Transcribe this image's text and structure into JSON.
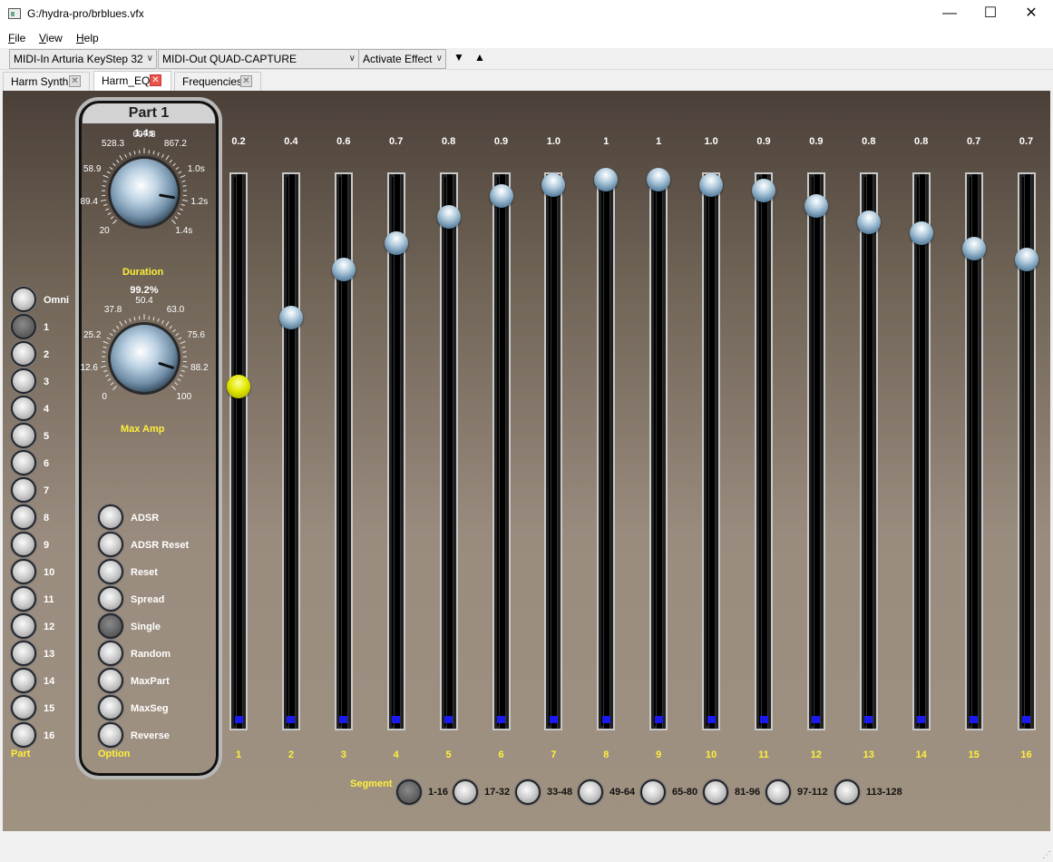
{
  "window": {
    "title": "G:/hydra-pro/brblues.vfx",
    "minimize": "—",
    "maximize": "☐",
    "close": "✕"
  },
  "menu": {
    "file": "File",
    "view": "View",
    "help": "Help"
  },
  "toolbar": {
    "midi_in": "MIDI-In Arturia KeyStep 32",
    "midi_out": "MIDI-Out QUAD-CAPTURE",
    "effect": "Activate Effect",
    "down_arrow": "▼",
    "up_arrow": "▲",
    "combo_arrow": "∨"
  },
  "tabs": [
    {
      "label": "Harm Synth",
      "active": false
    },
    {
      "label": "Harm_EQ",
      "active": true
    },
    {
      "label": "Frequencies",
      "active": false
    }
  ],
  "tab_close": "✕",
  "parts": {
    "items": [
      "Omni",
      "1",
      "2",
      "3",
      "4",
      "5",
      "6",
      "7",
      "8",
      "9",
      "10",
      "11",
      "12",
      "13",
      "14",
      "15",
      "16"
    ],
    "selected": "1",
    "label": "Part"
  },
  "panel": {
    "title": "Part 1",
    "duration": {
      "value": "1.4s",
      "label": "Duration",
      "ticks": [
        "20",
        "89.4",
        "58.9",
        "528.3",
        "697.8",
        "867.2",
        "1.0s",
        "1.2s",
        "1.4s"
      ],
      "level": 0.87
    },
    "max_amp": {
      "value": "99.2%",
      "label": "Max Amp",
      "ticks": [
        "0",
        "12.6",
        "25.2",
        "37.8",
        "50.4",
        "63.0",
        "75.6",
        "88.2",
        "100"
      ],
      "level": 0.9
    },
    "options": {
      "items": [
        "ADSR",
        "ADSR Reset",
        "Reset",
        "Spread",
        "Single",
        "Random",
        "MaxPart",
        "MaxSeg",
        "Reverse"
      ],
      "selected": "Single",
      "label": "Option"
    }
  },
  "sliders": {
    "labels": [
      "1",
      "2",
      "3",
      "4",
      "5",
      "6",
      "7",
      "8",
      "9",
      "10",
      "11",
      "12",
      "13",
      "14",
      "15",
      "16"
    ],
    "value_text": [
      "0.2",
      "0.4",
      "0.6",
      "0.7",
      "0.8",
      "0.9",
      "1.0",
      "1",
      "1",
      "1.0",
      "0.9",
      "0.9",
      "0.8",
      "0.8",
      "0.7",
      "0.7"
    ],
    "levels": [
      0.61,
      0.74,
      0.83,
      0.88,
      0.93,
      0.97,
      0.99,
      1.0,
      1.0,
      0.99,
      0.98,
      0.95,
      0.92,
      0.9,
      0.87,
      0.85
    ],
    "selected": "1"
  },
  "segments": {
    "label": "Segment",
    "items": [
      "1-16",
      "17-32",
      "33-48",
      "49-64",
      "65-80",
      "81-96",
      "97-112",
      "113-128"
    ],
    "selected": "1-16"
  },
  "colors": {
    "label_yellow": "#ffef3a",
    "thumb_selected": "#e2e800",
    "track_base": "#1a1af0"
  }
}
